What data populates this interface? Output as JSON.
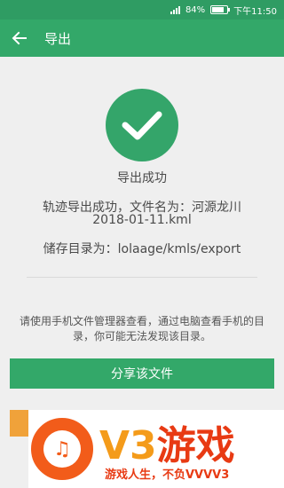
{
  "status_bar": {
    "battery": "84%",
    "time": "下午11:50"
  },
  "app_bar": {
    "title": "导出"
  },
  "result": {
    "headline": "导出成功",
    "file_line1": "轨迹导出成功，文件名为：河源龙川",
    "file_line2": "2018-01-11.kml",
    "directory": "储存目录为：lolaage/kmls/export"
  },
  "hint": "请使用手机文件管理器查看，通过电脑查看手机的目录，你可能无法发现该目录。",
  "share_button": "分享该文件",
  "watermark": {
    "brand_v3": "V3",
    "brand_text": "游戏",
    "slogan": "游戏人生，不负VVVV3"
  },
  "colors": {
    "primary": "#33a869",
    "status_bar": "#2f9c63",
    "watermark_orange": "#f25c1a"
  }
}
